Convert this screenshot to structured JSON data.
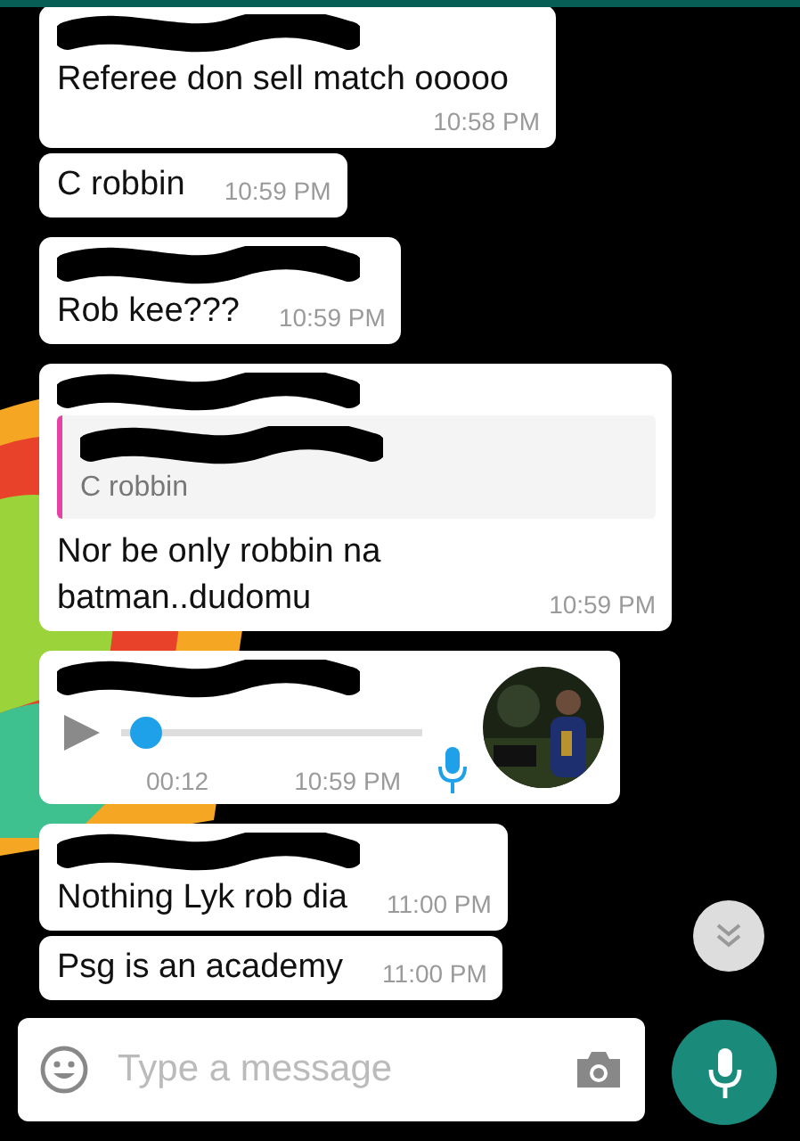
{
  "messages": [
    {
      "kind": "text",
      "sender_redacted": true,
      "text": "Referee don sell match ooooo",
      "time": "10:58 PM"
    },
    {
      "kind": "text",
      "sender_redacted": false,
      "text": "C robbin",
      "time": "10:59 PM"
    },
    {
      "kind": "text",
      "sender_redacted": true,
      "text": "Rob kee???",
      "time": "10:59 PM"
    },
    {
      "kind": "reply",
      "sender_redacted": true,
      "quote": {
        "text": "C robbin",
        "color": "#e542a3"
      },
      "text": "Nor be only robbin na batman..dudomu",
      "time": "10:59 PM"
    },
    {
      "kind": "voice",
      "sender_redacted": true,
      "level": 0.03,
      "duration": "00:12",
      "time": "10:59 PM"
    },
    {
      "kind": "text",
      "sender_redacted": true,
      "text": "Nothing Lyk rob dia",
      "time": "11:00 PM"
    },
    {
      "kind": "text",
      "sender_redacted": false,
      "text": "Psg is an academy",
      "time": "11:00 PM"
    }
  ],
  "compose": {
    "placeholder": "Type a message"
  }
}
